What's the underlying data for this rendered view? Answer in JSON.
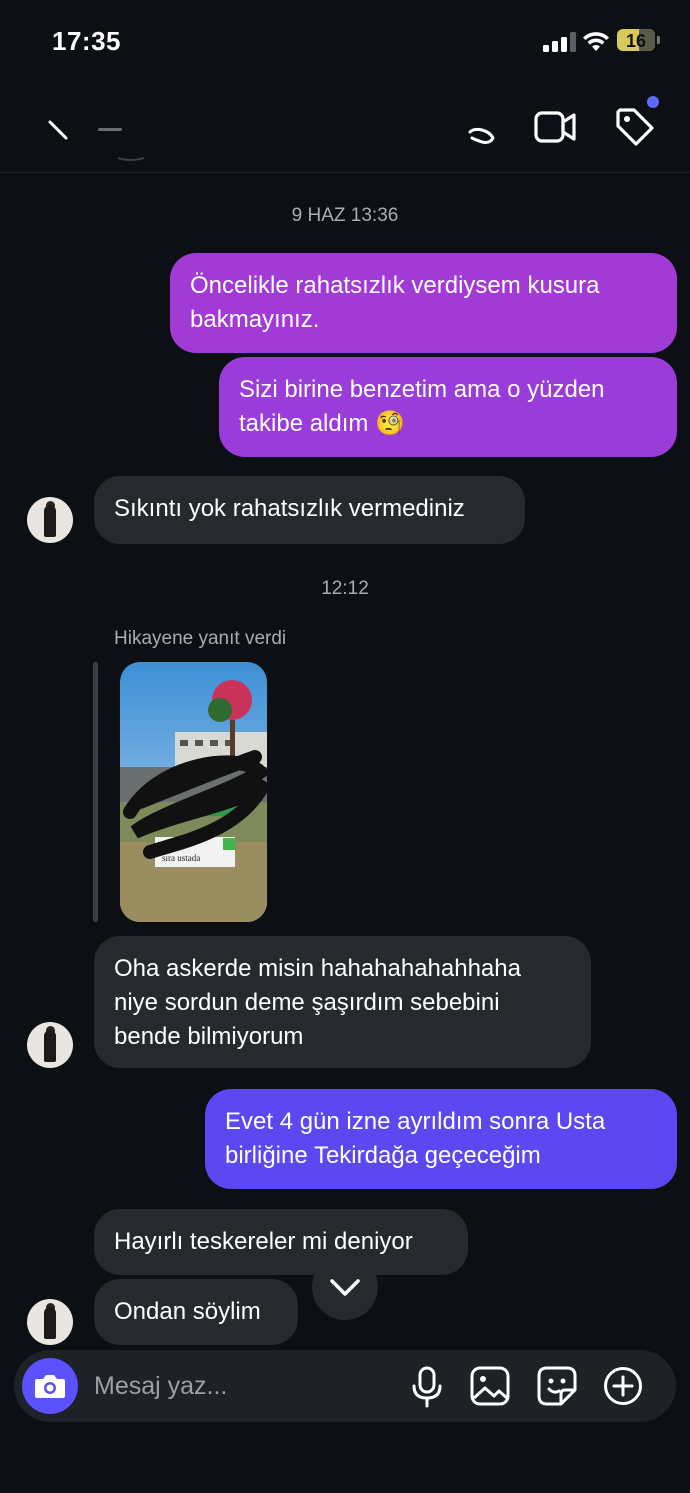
{
  "status_bar": {
    "time": "17:35",
    "battery": "16"
  },
  "header": {
    "video_call_icon": "video-icon",
    "tag_icon": "tag-icon"
  },
  "timestamps": {
    "first": "9 HAZ 13:36",
    "second": "12:12"
  },
  "messages": [
    {
      "from": "me",
      "text": "Öncelikle rahatsızlık verdiysem kusura bakmayınız."
    },
    {
      "from": "me",
      "text": "Sizi birine benzetim ama o yüzden takibe aldım 🧐"
    },
    {
      "from": "them",
      "text": "Sıkıntı yok rahatsızlık vermediniz"
    },
    {
      "from": "them",
      "text": "Oha askerde misin hahahahahahhaha niye sordun deme şaşırdım sebebini bende bilmiyorum"
    },
    {
      "from": "me",
      "text": "Evet 4 gün izne ayrıldım sonra Usta birliğine Tekirdağa geçeceğim"
    },
    {
      "from": "them",
      "text": "Hayırlı teskereler mi deniyor"
    },
    {
      "from": "them",
      "text": "Ondan söylim"
    }
  ],
  "story_reply": {
    "label": "Hikayene yanıt verdi",
    "caption": "sıra ustada"
  },
  "composer": {
    "placeholder": "Mesaj yaz..."
  },
  "colors": {
    "bubble_gradient_top": "#a23bd6",
    "bubble_gradient_bottom": "#5b48f0",
    "incoming_bubble": "#262a2f",
    "background": "#0c1014"
  }
}
